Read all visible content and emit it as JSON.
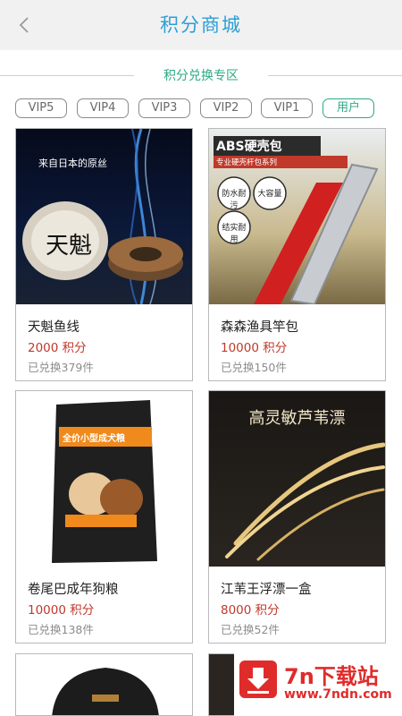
{
  "header": {
    "title": "积分商城"
  },
  "section": {
    "title": "积分兑换专区"
  },
  "tiers": [
    {
      "label": "VIP5",
      "active": false
    },
    {
      "label": "VIP4",
      "active": false
    },
    {
      "label": "VIP3",
      "active": false
    },
    {
      "label": "VIP2",
      "active": false
    },
    {
      "label": "VIP1",
      "active": false
    },
    {
      "label": "用户",
      "active": true
    }
  ],
  "products": [
    {
      "name": "天魁鱼线",
      "price": "2000 积分",
      "sold": "已兑换379件",
      "img_text": [
        "来自日本的原丝",
        "天魁"
      ]
    },
    {
      "name": "森森渔具竿包",
      "price": "10000 积分",
      "sold": "已兑换150件",
      "img_text": [
        "ABS硬壳包",
        "专业硬壳杆包系列",
        "防水耐污",
        "大容量",
        "结实耐用"
      ]
    },
    {
      "name": "卷尾巴成年狗粮",
      "price": "10000 积分",
      "sold": "已兑换138件",
      "img_text": [
        "全价小型成犬粮"
      ]
    },
    {
      "name": "江苇王浮漂一盒",
      "price": "8000 积分",
      "sold": "已兑换52件",
      "img_text": [
        "高灵敏芦苇漂"
      ]
    }
  ],
  "watermark": {
    "title": "7n下载站",
    "url": "www.7ndn.com"
  },
  "colors": {
    "accent": "#2a9fd6",
    "green": "#2eaa85",
    "price": "#c0392b"
  }
}
